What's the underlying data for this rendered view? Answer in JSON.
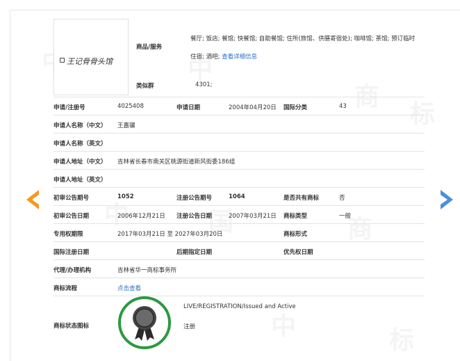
{
  "logo": {
    "text": "王记骨骨头馆"
  },
  "goods": {
    "label": "商品/服务",
    "line1": "餐厅; 饭店; 餐馆; 快餐馆; 自助餐馆; 住所(旅馆、供膳寄宿处); 咖啡馆; 茶馆; 预订临时",
    "line2": "住宿; 酒吧;",
    "link": "查看详细信息"
  },
  "similar": {
    "label": "类似群",
    "value": "4301;"
  },
  "rows": {
    "reg_no_label": "申请/注册号",
    "reg_no": "4025408",
    "apply_date_label": "申请日期",
    "apply_date": "2004年04月20日",
    "intl_class_label": "国际分类",
    "intl_class": "43",
    "applicant_cn_label": "申请人名称（中文）",
    "applicant_cn": "王嘉骥",
    "applicant_en_label": "申请人名称（英文）",
    "address_cn_label": "申请人地址（中文）",
    "address_cn": "吉林省长春市南关区桃源街道新风街委186组",
    "address_en_label": "申请人地址（英文）",
    "prelim_no_label": "初审公告期号",
    "prelim_no": "1052",
    "reg_pub_no_label": "注册公告期号",
    "reg_pub_no": "1064",
    "shared_label": "是否共有商标",
    "shared": "否",
    "prelim_date_label": "初审公告日期",
    "prelim_date": "2006年12月21日",
    "reg_pub_date_label": "注册公告日期",
    "reg_pub_date": "2007年03月21日",
    "type_label": "商标类型",
    "type": "一般",
    "exclusive_label": "专用权期限",
    "exclusive": "2017年03月21日 至 2027年03月20日",
    "form_label": "商标形式",
    "intl_reg_date_label": "国际注册日期",
    "later_date_label": "后期指定日期",
    "priority_date_label": "优先权日期",
    "agent_label": "代理/办理机构",
    "agent": "吉林省华一商标事务所",
    "flow_label": "商标流程",
    "flow_link": "点击查看",
    "status_label": "商标状态图标",
    "status_en": "LIVE/REGISTRATION/Issued and Active",
    "status_cn": "注册"
  },
  "colors": {
    "arrow_left": "#f39a1e",
    "arrow_right": "#4a90d9",
    "badge_ring": "#2a9a3f",
    "link": "#2a6fc9"
  },
  "icons": {
    "prev": "arrow-left-icon",
    "next": "arrow-right-icon",
    "status": "award-badge-icon"
  }
}
